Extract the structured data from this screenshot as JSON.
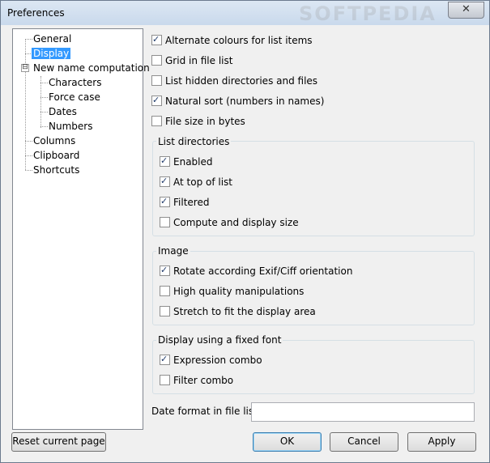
{
  "window": {
    "title": "Preferences",
    "close_glyph": "✕",
    "watermark": "SOFTPEDIA"
  },
  "tree": {
    "items": [
      {
        "label": "General",
        "level": 0,
        "selected": false
      },
      {
        "label": "Display",
        "level": 0,
        "selected": true
      },
      {
        "label": "New name computation",
        "level": 0,
        "selected": false,
        "expanded": true,
        "expander": "⊟"
      },
      {
        "label": "Characters",
        "level": 1,
        "selected": false
      },
      {
        "label": "Force case",
        "level": 1,
        "selected": false
      },
      {
        "label": "Dates",
        "level": 1,
        "selected": false
      },
      {
        "label": "Numbers",
        "level": 1,
        "selected": false
      },
      {
        "label": "Columns",
        "level": 0,
        "selected": false
      },
      {
        "label": "Clipboard",
        "level": 0,
        "selected": false
      },
      {
        "label": "Shortcuts",
        "level": 0,
        "selected": false
      }
    ]
  },
  "options": {
    "alternate_colours": {
      "label": "Alternate colours for list items",
      "checked": true
    },
    "grid": {
      "label": "Grid in file list",
      "checked": false
    },
    "hidden": {
      "label": "List hidden directories and files",
      "checked": false
    },
    "natural_sort": {
      "label": "Natural sort (numbers in names)",
      "checked": true
    },
    "file_size_bytes": {
      "label": "File size in bytes",
      "checked": false
    }
  },
  "list_directories": {
    "title": "List directories",
    "enabled": {
      "label": "Enabled",
      "checked": true
    },
    "at_top": {
      "label": "At top of list",
      "checked": true
    },
    "filtered": {
      "label": "Filtered",
      "checked": true
    },
    "compute_size": {
      "label": "Compute and display size",
      "checked": false
    }
  },
  "image": {
    "title": "Image",
    "rotate": {
      "label": "Rotate according Exif/Ciff orientation",
      "checked": true
    },
    "high_quality": {
      "label": "High quality manipulations",
      "checked": false
    },
    "stretch": {
      "label": "Stretch to fit the display area",
      "checked": false
    }
  },
  "fixed_font": {
    "title": "Display using a fixed font",
    "expression_combo": {
      "label": "Expression combo",
      "checked": true
    },
    "filter_combo": {
      "label": "Filter combo",
      "checked": false
    }
  },
  "date_format": {
    "label": "Date format in file list",
    "value": ""
  },
  "buttons": {
    "reset": "Reset current page",
    "ok": "OK",
    "cancel": "Cancel",
    "apply": "Apply"
  }
}
